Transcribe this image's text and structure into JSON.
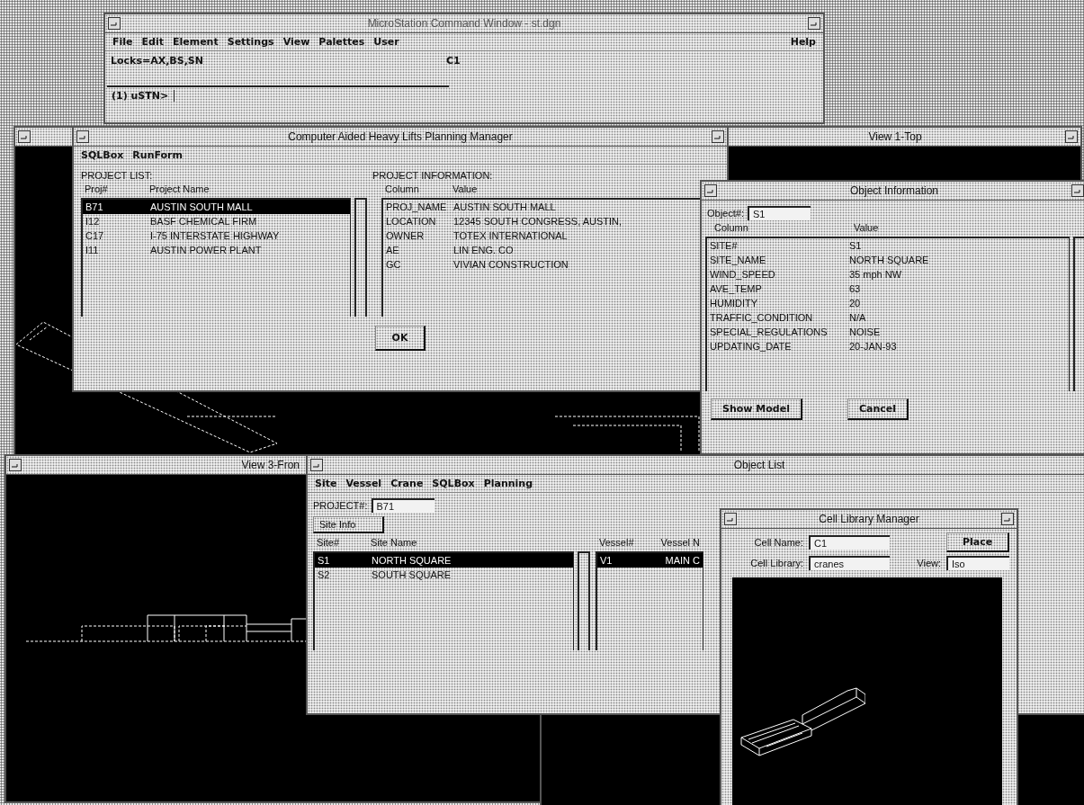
{
  "command_window": {
    "title": "MicroStation Command Window - st.dgn",
    "menu": [
      "File",
      "Edit",
      "Element",
      "Settings",
      "View",
      "Palettes",
      "User"
    ],
    "help_menu": "Help",
    "locks": "Locks=AX,BS,SN",
    "active_cell": "C1",
    "prompt": "(1) uSTN>"
  },
  "view_top": {
    "title": "View 1-Top"
  },
  "planning_manager": {
    "title": "Computer Aided Heavy Lifts Planning Manager",
    "menu": [
      "SQLBox",
      "RunForm"
    ],
    "project_list": {
      "label": "PROJECT LIST:",
      "columns": [
        "Proj#",
        "Project Name"
      ],
      "rows": [
        {
          "id": "B71",
          "name": "AUSTIN SOUTH MALL",
          "selected": true
        },
        {
          "id": "I12",
          "name": "BASF CHEMICAL FIRM",
          "selected": false
        },
        {
          "id": "C17",
          "name": "I-75 INTERSTATE HIGHWAY",
          "selected": false
        },
        {
          "id": "I11",
          "name": "AUSTIN POWER PLANT",
          "selected": false
        }
      ]
    },
    "project_info": {
      "label": "PROJECT INFORMATION:",
      "columns": [
        "Column",
        "Value"
      ],
      "rows": [
        {
          "column": "PROJ_NAME",
          "value": "AUSTIN SOUTH MALL"
        },
        {
          "column": "LOCATION",
          "value": "12345 SOUTH CONGRESS, AUSTIN,"
        },
        {
          "column": "OWNER",
          "value": "TOTEX INTERNATIONAL"
        },
        {
          "column": "AE",
          "value": "LIN ENG. CO"
        },
        {
          "column": "GC",
          "value": "VIVIAN CONSTRUCTION"
        }
      ]
    },
    "ok_button": "OK"
  },
  "object_information": {
    "title": "Object Information",
    "object_label": "Object#:",
    "object_value": "S1",
    "columns": [
      "Column",
      "Value"
    ],
    "rows": [
      {
        "column": "SITE#",
        "value": "S1"
      },
      {
        "column": "SITE_NAME",
        "value": "NORTH SQUARE"
      },
      {
        "column": "WIND_SPEED",
        "value": "35 mph NW"
      },
      {
        "column": "AVE_TEMP",
        "value": "63"
      },
      {
        "column": "HUMIDITY",
        "value": "20"
      },
      {
        "column": "TRAFFIC_CONDITION",
        "value": "N/A"
      },
      {
        "column": "SPECIAL_REGULATIONS",
        "value": "NOISE"
      },
      {
        "column": "UPDATING_DATE",
        "value": "20-JAN-93"
      }
    ],
    "buttons": [
      "Show Model",
      "Cancel"
    ]
  },
  "view_front": {
    "title": "View 3-Fron"
  },
  "object_list": {
    "title": "Object List",
    "menu": [
      "Site",
      "Vessel",
      "Crane",
      "SQLBox",
      "Planning"
    ],
    "project_label": "PROJECT#:",
    "project_value": "B71",
    "site_info_button": "Site Info",
    "sites": {
      "columns": [
        "Site#",
        "Site Name"
      ],
      "rows": [
        {
          "id": "S1",
          "name": "NORTH SQUARE",
          "selected": true
        },
        {
          "id": "S2",
          "name": "SOUTH SQUARE",
          "selected": false
        }
      ]
    },
    "vessels": {
      "columns": [
        "Vessel#",
        "Vessel N"
      ],
      "rows": [
        {
          "id": "V1",
          "name": "MAIN C",
          "selected": true
        }
      ]
    }
  },
  "cell_library": {
    "title": "Cell Library Manager",
    "cell_name_label": "Cell Name:",
    "cell_name": "C1",
    "place_button": "Place",
    "library_label": "Cell Library:",
    "library": "cranes",
    "view_label": "View:",
    "view": "Iso"
  }
}
